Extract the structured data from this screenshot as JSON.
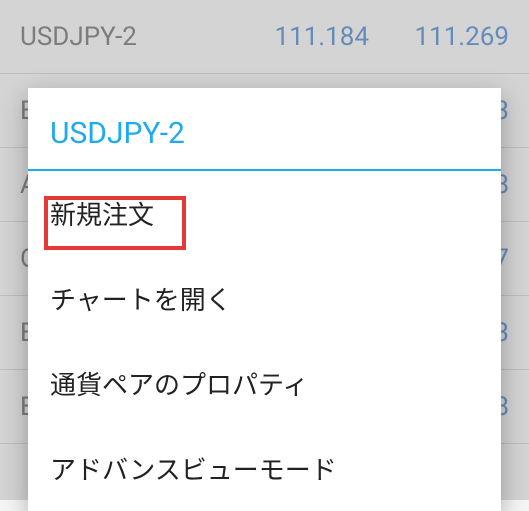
{
  "background": {
    "rows": [
      {
        "symbol": "USDJPY-2",
        "bid": "111.184",
        "ask": "111.269"
      },
      {
        "symbol": "E",
        "bid": "",
        "ask": "3"
      },
      {
        "symbol": "A",
        "bid": "",
        "ask": "8"
      },
      {
        "symbol": "G",
        "bid": "",
        "ask": "7"
      },
      {
        "symbol": "B",
        "bid": "",
        "ask": "3"
      },
      {
        "symbol": "E",
        "bid": "",
        "ask": "8"
      }
    ]
  },
  "dialog": {
    "title": "USDJPY-2",
    "items": [
      {
        "label": "新規注文"
      },
      {
        "label": "チャートを開く"
      },
      {
        "label": "通貨ペアのプロパティ"
      },
      {
        "label": "アドバンスビューモード"
      }
    ]
  }
}
